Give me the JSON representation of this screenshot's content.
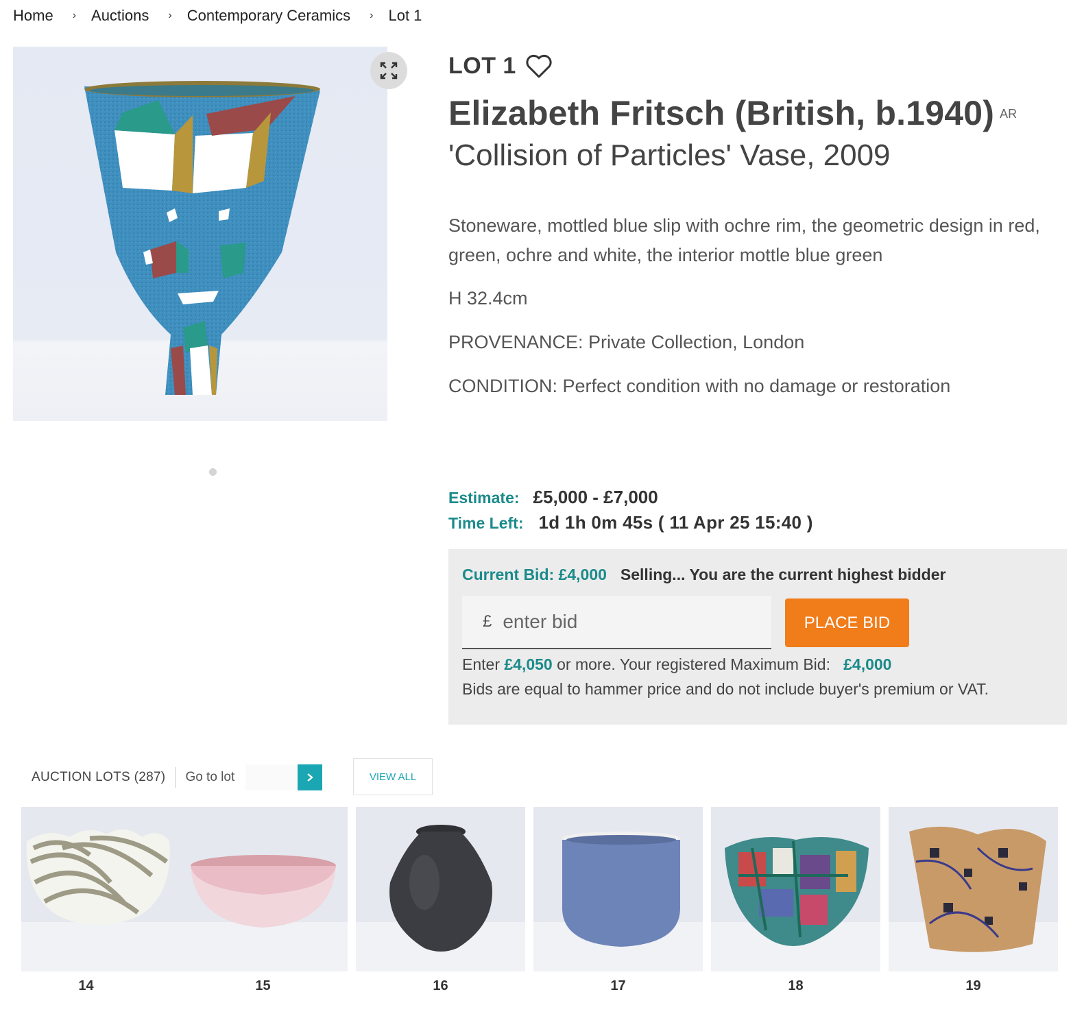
{
  "breadcrumb": {
    "home": "Home",
    "auctions": "Auctions",
    "category": "Contemporary Ceramics",
    "current": "Lot 1"
  },
  "lot": {
    "number": "LOT 1",
    "artist": "Elizabeth Fritsch (British, b.1940)",
    "ar_badge": "AR",
    "title": "'Collision of Particles' Vase, 2009",
    "description": "Stoneware, mottled blue slip with ochre rim, the geometric design in red, green, ochre and white, the interior mottle blue green",
    "dimensions": "H 32.4cm",
    "provenance": "PROVENANCE: Private Collection, London",
    "condition": "CONDITION: Perfect condition with no damage or restoration"
  },
  "estimate": {
    "label": "Estimate:",
    "value": "£5,000 - £7,000"
  },
  "time_left": {
    "label": "Time Left:",
    "value": "1d 1h 0m 45s ( 11 Apr 25 15:40 )"
  },
  "bid_panel": {
    "current_bid": "Current Bid: £4,000",
    "status": "Selling... You are the current highest bidder",
    "currency_symbol": "£",
    "input_placeholder": "enter bid",
    "place_bid_label": "PLACE BID",
    "enter_prefix": "Enter",
    "min_bid": "£4,050",
    "enter_suffix": "or more. Your registered Maximum Bid:",
    "max_bid": "£4,000",
    "disclaimer": "Bids are equal to hammer price and do not include buyer's premium or VAT."
  },
  "lots_bar": {
    "count_label": "AUCTION LOTS (287)",
    "goto_label": "Go to lot",
    "view_all_label": "VIEW ALL"
  },
  "thumbnails": [
    {
      "lot": "14",
      "kind": "striped-bowl"
    },
    {
      "lot": "15",
      "kind": "pink-bowl"
    },
    {
      "lot": "16",
      "kind": "black-pot"
    },
    {
      "lot": "17",
      "kind": "blue-cup"
    },
    {
      "lot": "18",
      "kind": "multicolor-bowl"
    },
    {
      "lot": "19",
      "kind": "patterned-vessel"
    }
  ],
  "colors": {
    "teal": "#1b8a8a",
    "accent_orange": "#f07c1a",
    "goto_teal": "#1aa6b2",
    "panel_gray": "#ececec"
  }
}
